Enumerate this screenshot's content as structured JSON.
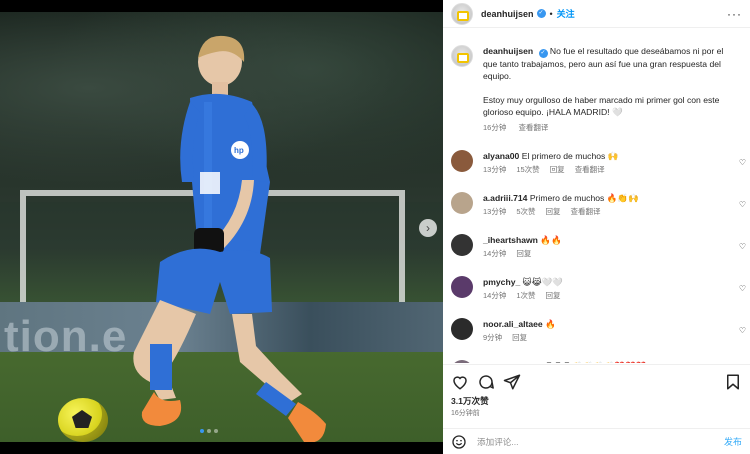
{
  "post": {
    "username": "deanhuijsen",
    "follow_label": "关注",
    "more_label": "···",
    "separator": "•",
    "media_dots": 3,
    "media_active_dot": 1,
    "caption": {
      "username": "deanhuijsen",
      "text1": "No fue el resultado que deseábamos ni por el que tanto trabajamos, pero aun así fue una gran respuesta del equipo.",
      "text2": "Estoy muy orgulloso de haber marcado mi primer gol con este glorioso equipo. ¡HALA MADRID! 🤍",
      "time": "16分钟",
      "translate": "查看翻译"
    },
    "comments": [
      {
        "username": "alyana00",
        "text": "El primero de muchos 🙌",
        "time": "13分钟",
        "likes": "15次赞",
        "reply": "回复",
        "translate": "查看翻译",
        "avatar_color": "#8a5a3c"
      },
      {
        "username": "a.adriii.714",
        "text": "Primero de muchos 🔥👏🙌",
        "time": "13分钟",
        "likes": "5次赞",
        "reply": "回复",
        "translate": "查看翻译",
        "avatar_color": "#b8a48c"
      },
      {
        "username": "_iheartshawn",
        "text": "🔥🔥",
        "time": "14分钟",
        "likes": "",
        "reply": "回复",
        "translate": "",
        "avatar_color": "#333333"
      },
      {
        "username": "pmychy_",
        "text": "😺😹🤍🤍",
        "time": "14分钟",
        "likes": "1次赞",
        "reply": "回复",
        "translate": "",
        "avatar_color": "#5a3a6a"
      },
      {
        "username": "noor.ali_altaee",
        "text": "🔥",
        "time": "9分钟",
        "likes": "",
        "reply": "回复",
        "translate": "",
        "avatar_color": "#2b2b2b"
      },
      {
        "username": "_lady_roses_s",
        "text": "😍😍😍👏👏👏👏❤️❤️❤️",
        "time": "",
        "likes": "",
        "reply": "",
        "translate": "",
        "avatar_color": "#7a6b7a"
      }
    ],
    "likes_total": "3.1万次赞",
    "posted_time": "16分钟前",
    "add_comment_placeholder": "添加评论...",
    "post_label": "发布",
    "board_text": "tion.e",
    "next_arrow": "›",
    "heart_glyph": "♡"
  }
}
